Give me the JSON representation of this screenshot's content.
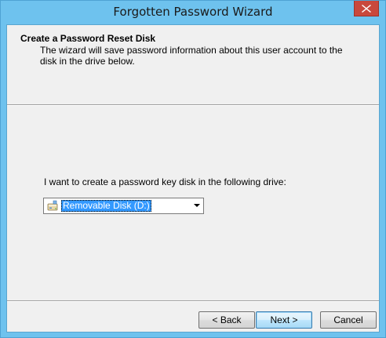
{
  "window": {
    "title": "Forgotten Password Wizard",
    "close_icon": "close-icon",
    "accent_color": "#6ec2ee",
    "close_color": "#c9483c"
  },
  "header": {
    "title": "Create a Password Reset Disk",
    "description": "The wizard will save password information about this user account to the disk in the drive below."
  },
  "body": {
    "prompt": "I want to create a password key disk in the following drive:",
    "drive_select": {
      "selected": "Removable Disk (D:)",
      "icon": "removable-disk-icon"
    }
  },
  "buttons": {
    "back": "< Back",
    "next": "Next >",
    "cancel": "Cancel"
  }
}
